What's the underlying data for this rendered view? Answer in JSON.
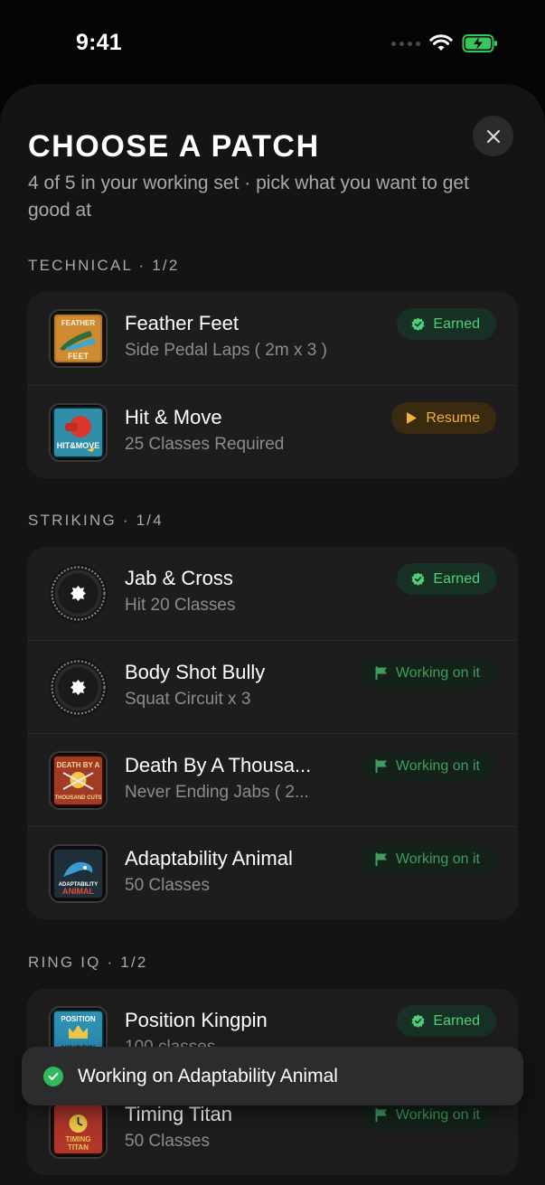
{
  "status_bar": {
    "time": "9:41"
  },
  "header": {
    "title": "CHOOSE A PATCH",
    "subtitle": "4 of 5 in your working set · pick what you want to get good at"
  },
  "sections": [
    {
      "label": "TECHNICAL",
      "count": "· 1/2",
      "items": [
        {
          "name": "Feather Feet",
          "detail": "Side Pedal Laps ( 2m x 3 )",
          "status": "Earned",
          "patch_text": "FEATHER FEET",
          "icon": "shield-check-icon"
        },
        {
          "name": "Hit & Move",
          "detail": "25 Classes Required",
          "status": "Resume",
          "patch_text": "HIT&MOVE",
          "icon": "play-icon"
        }
      ]
    },
    {
      "label": "STRIKING",
      "count": "· 1/4",
      "items": [
        {
          "name": "Jab & Cross",
          "detail": "Hit 20 Classes",
          "status": "Earned",
          "icon": "shield-check-icon"
        },
        {
          "name": "Body Shot Bully",
          "detail": "Squat Circuit x 3",
          "status": "Working on it",
          "icon": "flag-icon"
        },
        {
          "name": "Death By A Thousa...",
          "detail": "Never Ending Jabs ( 2...",
          "status": "Working on it",
          "patch_text": "DEATH BY A THOUSAND CUTS",
          "icon": "flag-icon"
        },
        {
          "name": "Adaptability Animal",
          "detail": "50 Classes",
          "status": "Working on it",
          "patch_text": "ADAPTABILITY ANIMAL",
          "icon": "flag-icon"
        }
      ]
    },
    {
      "label": "RING IQ",
      "count": "· 1/2",
      "items": [
        {
          "name": "Position Kingpin",
          "detail": "100 classes",
          "status": "Earned",
          "patch_text": "POSITION KINGPIN",
          "icon": "shield-check-icon"
        },
        {
          "name": "Timing Titan",
          "detail": "50 Classes",
          "status": "Working on it",
          "patch_text": "TIMING TITAN",
          "icon": "flag-icon"
        }
      ]
    }
  ],
  "toast": {
    "message": "Working on Adaptability Animal"
  },
  "colors": {
    "earned": "#4fce7c",
    "resume": "#f0b03c",
    "working": "#3f9e5f",
    "background": "#141414"
  }
}
